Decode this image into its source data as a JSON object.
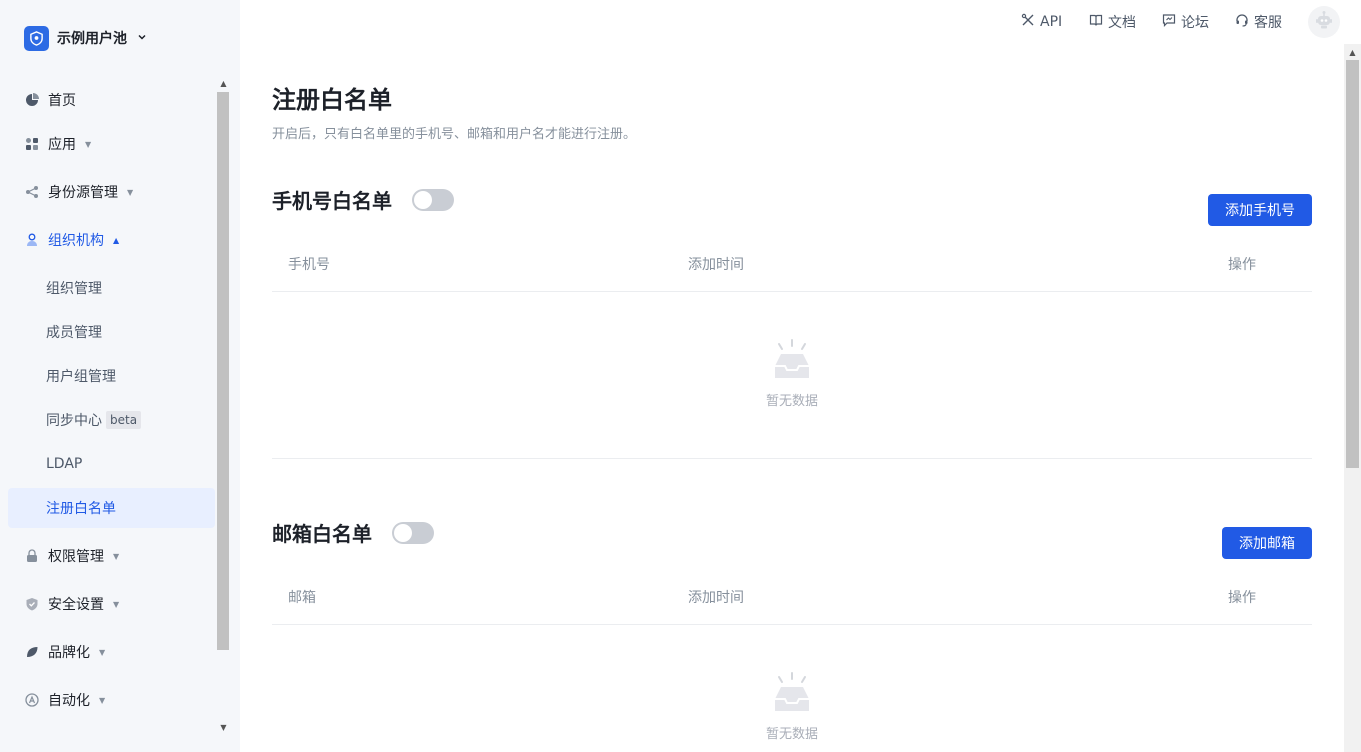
{
  "sidebar": {
    "pool_name": "示例用户池",
    "menu": {
      "home": "首页",
      "apps": "应用",
      "identity": "身份源管理",
      "org": "组织机构",
      "org_sub": {
        "org_mgmt": "组织管理",
        "members": "成员管理",
        "groups": "用户组管理",
        "sync": "同步中心",
        "sync_badge": "beta",
        "ldap": "LDAP",
        "whitelist": "注册白名单"
      },
      "permission": "权限管理",
      "security": "安全设置",
      "branding": "品牌化",
      "automation": "自动化"
    }
  },
  "topbar": {
    "api": "API",
    "docs": "文档",
    "forum": "论坛",
    "support": "客服"
  },
  "main": {
    "title": "注册白名单",
    "description": "开启后，只有白名单里的手机号、邮箱和用户名才能进行注册。",
    "phone": {
      "title": "手机号白名单",
      "add_button": "添加手机号",
      "columns": [
        "手机号",
        "添加时间",
        "操作"
      ],
      "empty": "暂无数据",
      "enabled": false
    },
    "email": {
      "title": "邮箱白名单",
      "add_button": "添加邮箱",
      "columns": [
        "邮箱",
        "添加时间",
        "操作"
      ],
      "empty": "暂无数据",
      "enabled": false
    }
  },
  "colors": {
    "primary": "#215ae5",
    "active_bg": "#e8efff",
    "sidebar_bg": "#f5f7fa"
  }
}
